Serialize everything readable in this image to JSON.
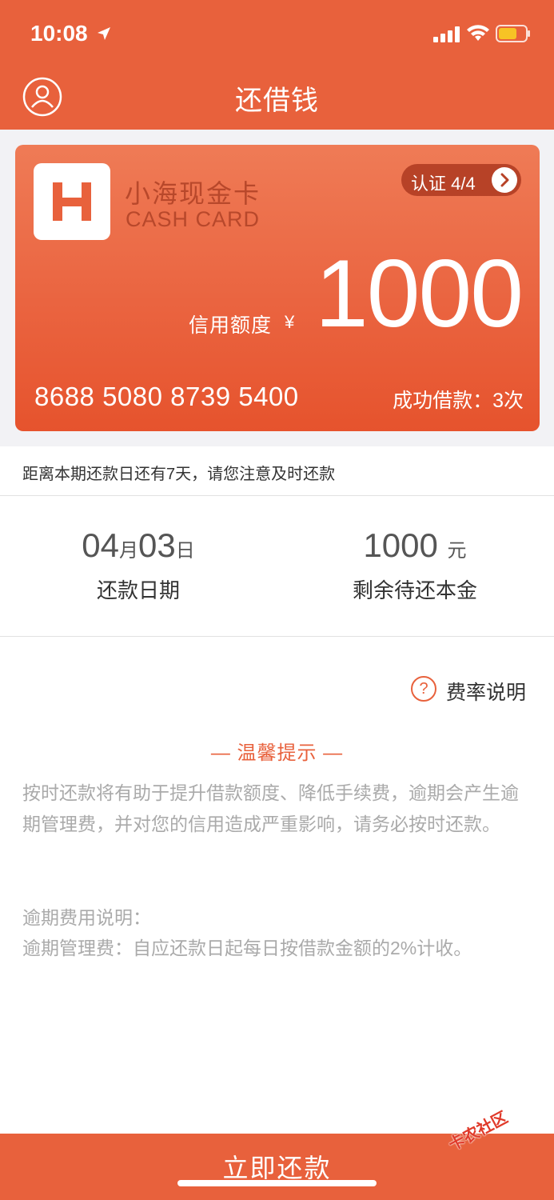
{
  "status_bar": {
    "time": "10:08"
  },
  "nav": {
    "title": "还借钱"
  },
  "card": {
    "brand_cn": "小海现金卡",
    "brand_en": "CASH CARD",
    "auth_label": "认证 4/4",
    "limit_label": "信用额度",
    "currency": "¥",
    "limit_amount": "1000",
    "card_number": "8688 5080 8739 5400",
    "loan_count": "成功借款：3次"
  },
  "notice": {
    "text": "距离本期还款日还有7天，请您注意及时还款"
  },
  "info": {
    "date_month": "04",
    "date_month_unit": "月",
    "date_day": "03",
    "date_day_unit": "日",
    "date_label": "还款日期",
    "principal_amount": "1000",
    "principal_unit": "元",
    "principal_label": "剩余待还本金"
  },
  "fee_link": {
    "icon": "?",
    "label": "费率说明"
  },
  "tips": {
    "title": "— 温馨提示 —",
    "body": "按时还款将有助于提升借款额度、降低手续费，逾期会产生逾期管理费，并对您的信用造成严重影响，请务必按时还款。",
    "fee_title": "逾期费用说明：",
    "fee_body": "逾期管理费：自应还款日起每日按借款金额的2%计收。"
  },
  "repay_button": {
    "label": "立即还款"
  },
  "watermark": {
    "text": "卡农社区"
  },
  "colors": {
    "accent": "#e8613c",
    "card_dark": "#b74227",
    "muted_text": "#aaaaaa"
  }
}
